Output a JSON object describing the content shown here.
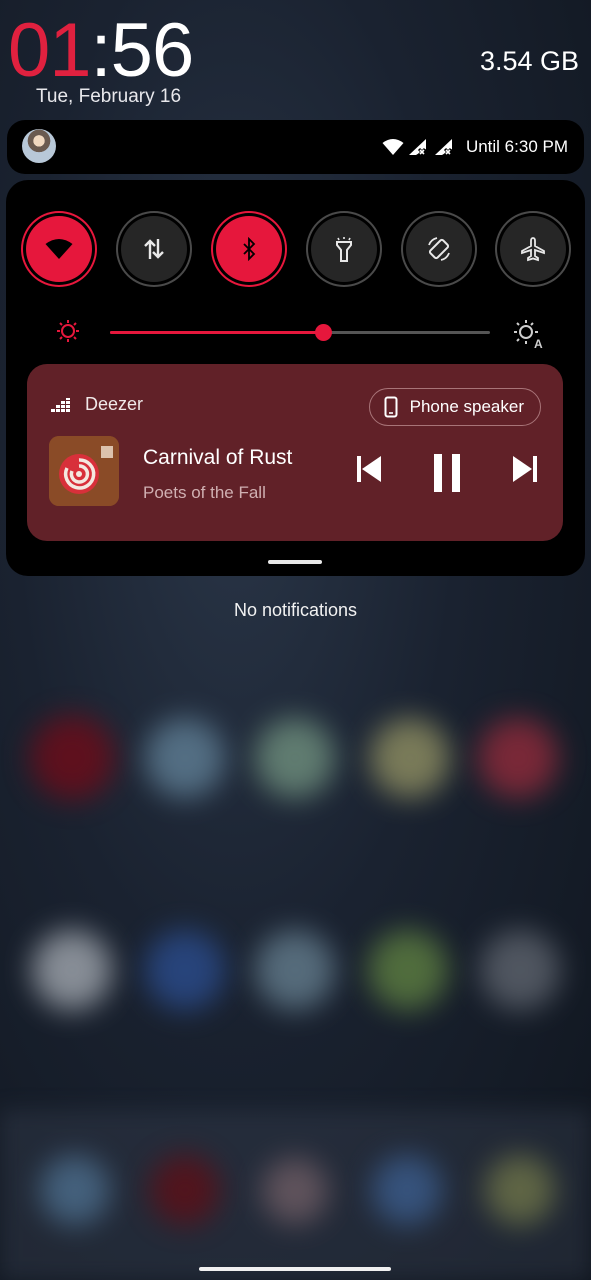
{
  "header": {
    "clock_hours": "01",
    "clock_separator": ":",
    "clock_minutes": "56",
    "date": "Tue, February 16",
    "storage": "3.54 GB"
  },
  "status_bar": {
    "dnd_label": "Until 6:30 PM",
    "icons": [
      "wifi-icon",
      "signal-no-service-icon",
      "signal-no-service-icon"
    ]
  },
  "quick_settings": {
    "tiles": [
      {
        "name": "wifi",
        "icon": "wifi-icon",
        "on": true
      },
      {
        "name": "mobile-data",
        "icon": "data-transfer-icon",
        "on": false
      },
      {
        "name": "bluetooth",
        "icon": "bluetooth-icon",
        "on": true
      },
      {
        "name": "flashlight",
        "icon": "flashlight-icon",
        "on": false
      },
      {
        "name": "auto-rotate",
        "icon": "auto-rotate-icon",
        "on": false
      },
      {
        "name": "airplane-mode",
        "icon": "airplane-icon",
        "on": false
      }
    ],
    "brightness_level": 0.56
  },
  "media": {
    "app_name": "Deezer",
    "output_label": "Phone speaker",
    "title": "Carnival of Rust",
    "artist": "Poets of the Fall",
    "state": "playing"
  },
  "notifications": {
    "empty_text": "No notifications"
  },
  "colors": {
    "accent": "#e6173c",
    "clock_hours": "#e0213f",
    "media_card": "#612128",
    "panel": "#000000"
  }
}
